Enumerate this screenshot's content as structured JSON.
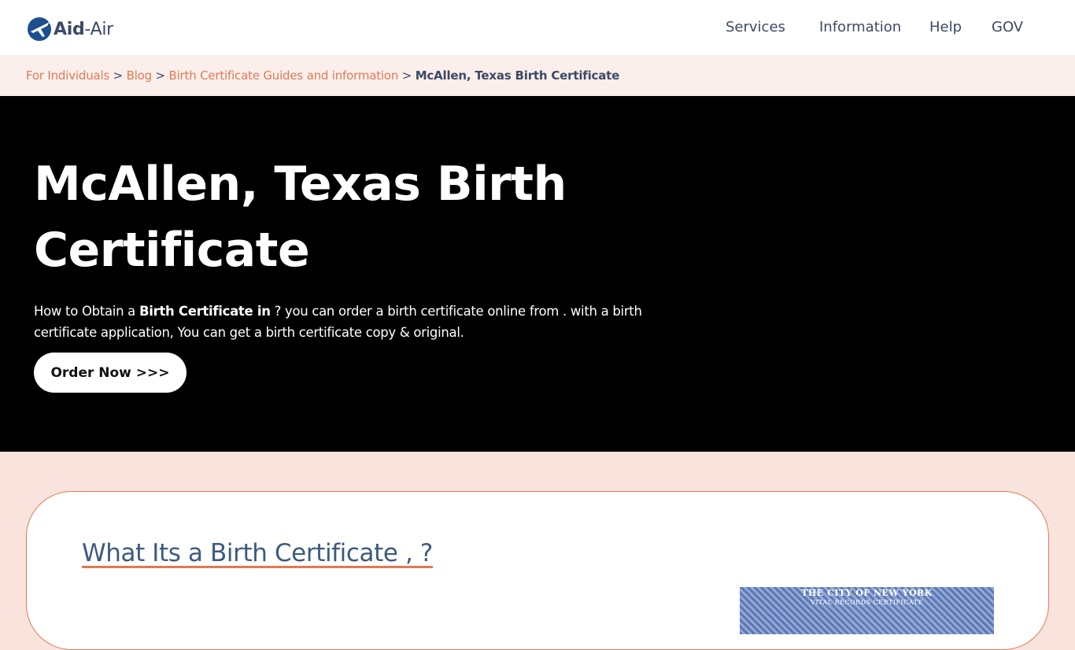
{
  "brand": {
    "name_bold": "Aid",
    "name_rest": "-Air",
    "icon": "airplane-globe-icon",
    "accent_color": "#e07a55",
    "navy_color": "#3b4a66"
  },
  "nav": {
    "items": [
      {
        "label": "Services"
      },
      {
        "label": "Information"
      },
      {
        "label": "Help"
      },
      {
        "label": "GOV"
      }
    ]
  },
  "breadcrumb": {
    "links": [
      {
        "label": "For Individuals"
      },
      {
        "label": "Blog"
      },
      {
        "label": "Birth Certificate Guides and information"
      }
    ],
    "separator": ">",
    "current": "McAllen, Texas Birth Certificate"
  },
  "hero": {
    "title": "McAllen, Texas Birth Certificate",
    "desc_prefix": "How to Obtain a ",
    "desc_bold": "Birth Certificate in",
    "desc_suffix": " ? you can order a birth certificate online from . with a birth certificate application, You can get a birth certificate copy & original.",
    "button_label": "Order Now >>>"
  },
  "content": {
    "heading": "What Its a Birth Certificate , ?",
    "image_caption_line1": "THE CITY OF NEW YORK",
    "image_caption_line2": "VITAL RECORDS CERTIFICATE"
  }
}
